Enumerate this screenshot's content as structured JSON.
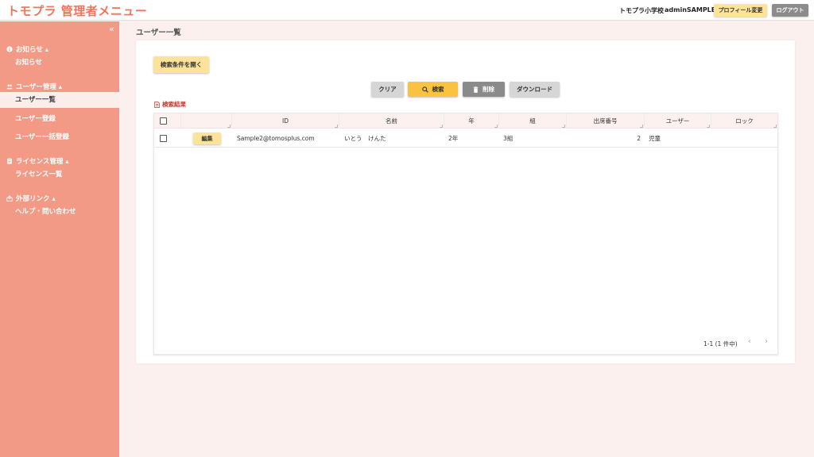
{
  "header": {
    "logo": "トモプラ 管理者メニュー",
    "school": "トモプラ小学校",
    "admin": "adminSAMPLE",
    "profile_button": "プロフィール変更",
    "logout_button": "ログアウト"
  },
  "sidebar": {
    "collapse_icon": "«",
    "sections": [
      {
        "title": "お知らせ ▴",
        "icon": "info-icon",
        "items": [
          "お知らせ"
        ]
      },
      {
        "title": "ユーザー管理 ▴",
        "icon": "users-icon",
        "items": [
          "ユーザー一覧",
          "ユーザー登録",
          "ユーザー一括登録"
        ]
      },
      {
        "title": "ライセンス管理 ▴",
        "icon": "license-icon",
        "items": [
          "ライセンス一覧"
        ]
      },
      {
        "title": "外部リンク ▴",
        "icon": "external-link-icon",
        "items": [
          "ヘルプ・問い合わせ"
        ]
      }
    ],
    "active_item": "ユーザー一覧"
  },
  "page_title": "ユーザー一覧",
  "toolbar": {
    "open_search": "検索条件を開く",
    "clear": "クリア",
    "search": "検索",
    "delete": "削除",
    "download": "ダウンロード"
  },
  "result_label": "検索結果",
  "table": {
    "columns": [
      "",
      "",
      "ID",
      "名前",
      "年",
      "組",
      "出席番号",
      "ユーザー",
      "ロック"
    ],
    "rows": [
      {
        "edit_label": "編集",
        "id": "Sample2@tomosplus.com",
        "name": "いとう　けんた",
        "grade": "2年",
        "class": "3組",
        "number": "2",
        "user_type": "児童",
        "lock": ""
      }
    ]
  },
  "pagination": {
    "summary": "1-1 (1 件中)",
    "prev": "‹",
    "next": "›"
  }
}
